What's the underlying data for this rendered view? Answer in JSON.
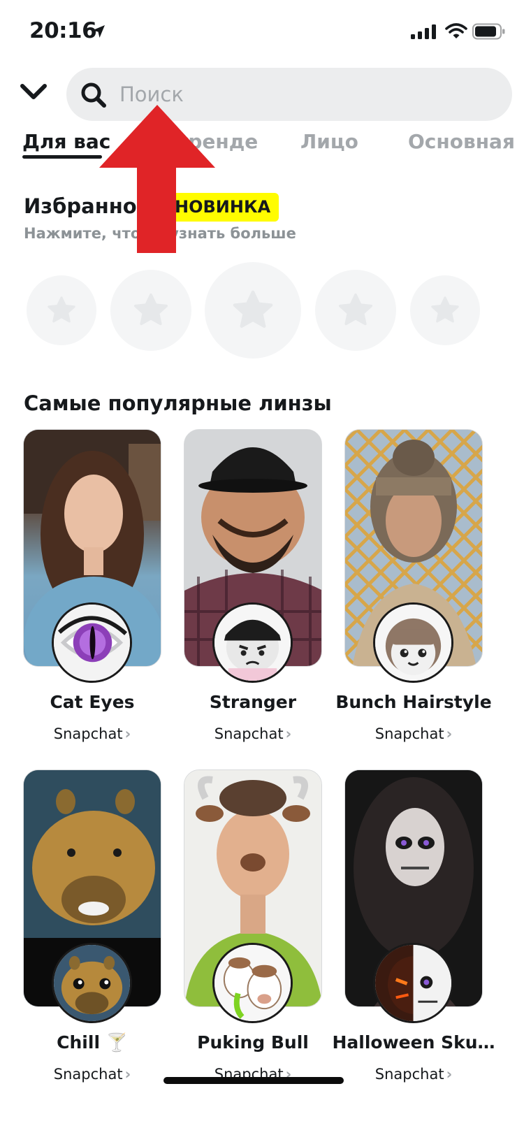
{
  "status_bar": {
    "time": "20:16"
  },
  "search": {
    "placeholder": "Поиск"
  },
  "tabs": [
    {
      "label": "Для вас",
      "active": true
    },
    {
      "label": "В тренде",
      "active": false
    },
    {
      "label": "Лицо",
      "active": false
    },
    {
      "label": "Основная",
      "active": false
    }
  ],
  "favorites": {
    "title": "Избранное",
    "badge": "НОВИНКА",
    "hint": "Нажмите, чтобы узнать больше",
    "empty_slots": 5
  },
  "popular": {
    "title": "Самые популярные линзы",
    "lenses": [
      {
        "name": "Cat Eyes",
        "creator": "Snapchat"
      },
      {
        "name": "Stranger",
        "creator": "Snapchat"
      },
      {
        "name": "Bunch Hairstyle",
        "creator": "Snapchat"
      },
      {
        "name": "Chill 🍸",
        "creator": "Snapchat"
      },
      {
        "name": "Puking Bull",
        "creator": "Snapchat"
      },
      {
        "name": "Halloween Sku…",
        "creator": "Snapchat"
      }
    ]
  },
  "colors": {
    "accent_yellow": "#fffc00",
    "annotation_red": "#e02427",
    "text_primary": "#16191c",
    "text_muted": "#a3a7ab",
    "search_bg": "#ecedee"
  },
  "icons": [
    "location-arrow-icon",
    "signal-icon",
    "wifi-icon",
    "battery-icon",
    "chevron-down-icon",
    "search-icon",
    "star-icon",
    "chevron-right-icon"
  ]
}
